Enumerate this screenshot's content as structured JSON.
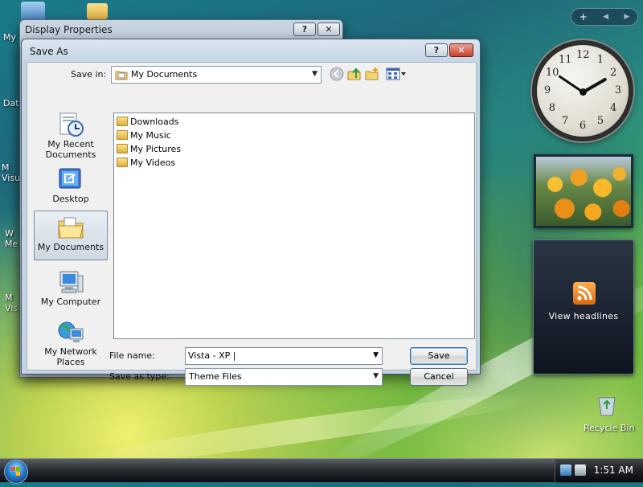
{
  "desktop": {
    "icons": [
      {
        "label": "My"
      },
      {
        "label": "Dat"
      },
      {
        "label": "M Visu"
      },
      {
        "label": "W Me"
      },
      {
        "label": "M Vis"
      }
    ],
    "recycle_bin": "Recycle Bin"
  },
  "sidebar": {
    "controls": {
      "add": "+",
      "prev": "◀",
      "next": "▶"
    },
    "clock_numbers": [
      "12",
      "1",
      "2",
      "3",
      "4",
      "5",
      "6",
      "7",
      "8",
      "9",
      "10",
      "11"
    ],
    "feed_label": "View headlines"
  },
  "taskbar": {
    "time": "1:51 AM"
  },
  "background_window": {
    "title": "Display Properties",
    "help": "?",
    "close": "✕"
  },
  "dialog": {
    "title": "Save As",
    "help": "?",
    "close": "✕",
    "save_in_label": "Save in:",
    "save_in_value": "My Documents",
    "places": [
      {
        "label": "My Recent Documents",
        "icon": "recent-documents-icon"
      },
      {
        "label": "Desktop",
        "icon": "desktop-icon"
      },
      {
        "label": "My Documents",
        "icon": "my-documents-icon"
      },
      {
        "label": "My Computer",
        "icon": "my-computer-icon"
      },
      {
        "label": "My Network Places",
        "icon": "network-places-icon"
      }
    ],
    "files": [
      {
        "name": "Downloads",
        "icon": "folder-icon"
      },
      {
        "name": "My Music",
        "icon": "music-folder-icon"
      },
      {
        "name": "My Pictures",
        "icon": "pictures-folder-icon"
      },
      {
        "name": "My Videos",
        "icon": "videos-folder-icon"
      }
    ],
    "file_name_label": "File name:",
    "file_name_value": "Vista - XP |",
    "save_type_label": "Save as type:",
    "save_type_value": "Theme Files",
    "save_button": "Save",
    "cancel_button": "Cancel"
  }
}
